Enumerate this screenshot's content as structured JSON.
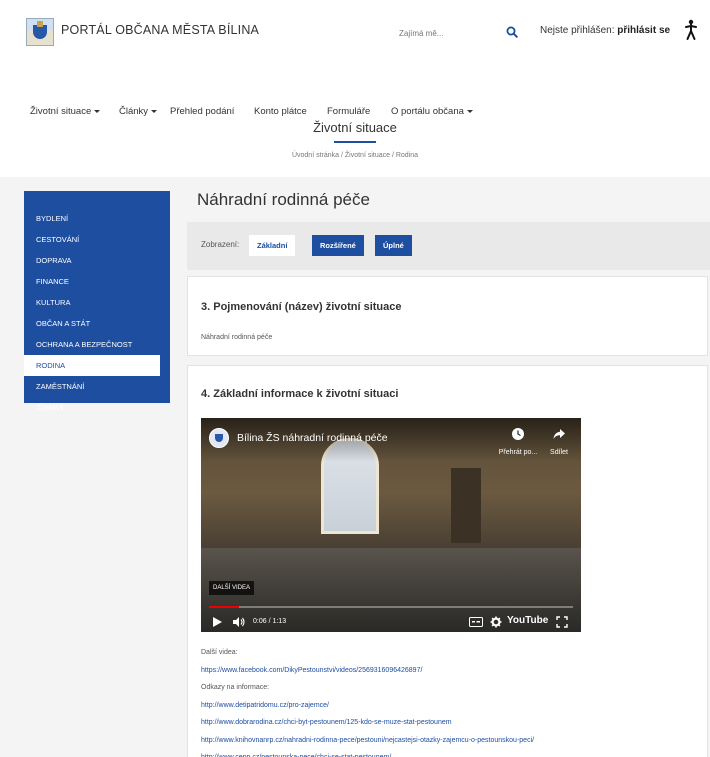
{
  "header": {
    "portal_title": "PORTÁL OBČANA MĚSTA BÍLINA",
    "search_placeholder": "Zajímá mě...",
    "login_prefix": "Nejste přihlášen:",
    "login_link": "přihlásit se"
  },
  "nav": {
    "items": [
      {
        "label": "Životní situace",
        "has_caret": true
      },
      {
        "label": "Články",
        "has_caret": true
      },
      {
        "label": "Přehled podání",
        "has_caret": false
      },
      {
        "label": "Konto plátce",
        "has_caret": false
      },
      {
        "label": "Formuláře",
        "has_caret": false
      },
      {
        "label": "O portálu občana",
        "has_caret": true
      }
    ]
  },
  "page": {
    "title": "Životní situace",
    "breadcrumb": "Úvodní stránka / Životní situace / Rodina"
  },
  "sidebar": {
    "items": [
      {
        "label": "BYDLENÍ",
        "active": false
      },
      {
        "label": "CESTOVÁNÍ",
        "active": false
      },
      {
        "label": "DOPRAVA",
        "active": false
      },
      {
        "label": "FINANCE",
        "active": false
      },
      {
        "label": "KULTURA",
        "active": false
      },
      {
        "label": "OBČAN A STÁT",
        "active": false
      },
      {
        "label": "OCHRANA A BEZPEČNOST",
        "active": false
      },
      {
        "label": "RODINA",
        "active": true
      },
      {
        "label": "ZAMĚSTNÁNÍ",
        "active": false
      },
      {
        "label": "ZDRAVÍ",
        "active": false
      }
    ]
  },
  "main": {
    "title": "Náhradní rodinná péče",
    "display": {
      "label": "Zobrazení:",
      "basic": "Základní",
      "extended": "Rozšířené",
      "full": "Úplné"
    },
    "section3": {
      "heading": "3. Pojmenování (název) životní situace",
      "text": "Náhradní rodinná péče"
    },
    "section4": {
      "heading": "4. Základní informace k životní situaci",
      "video": {
        "title": "Bílina ŽS náhradní rodinná péče",
        "watch_later": "Přehrát po...",
        "share": "Sdílet",
        "more_videos": "DALŠÍ VIDEA",
        "time": "0:06 / 1:13",
        "progress": 0.082,
        "brand": "YouTube"
      },
      "links": [
        {
          "text": "Další videa:",
          "kind": "label"
        },
        {
          "text": "https://www.facebook.com/DikyPestounstvi/videos/2569316096426897/",
          "kind": "link"
        },
        {
          "text": "Odkazy na informace:",
          "kind": "label"
        },
        {
          "text": "http://www.detipatridomu.cz/pro-zajemce/",
          "kind": "link"
        },
        {
          "text": "http://www.dobrarodina.cz/chci-byt-pestounem/125-kdo-se-muze-stat-pestounem",
          "kind": "link"
        },
        {
          "text": "http://www.knihovnanrp.cz/nahradni-rodinna-pece/pestouni/nejcastejsi-otazky-zajemcu-o-pestounskou-peci/",
          "kind": "link"
        },
        {
          "text": "http://www.cepp.cz/pestounska-pece/chci-se-stat-pestounem/",
          "kind": "link"
        }
      ]
    }
  },
  "colors": {
    "brand_blue": "#1d4ea0",
    "band_grey": "#f4f4f4",
    "progress_red": "#ee0000"
  }
}
